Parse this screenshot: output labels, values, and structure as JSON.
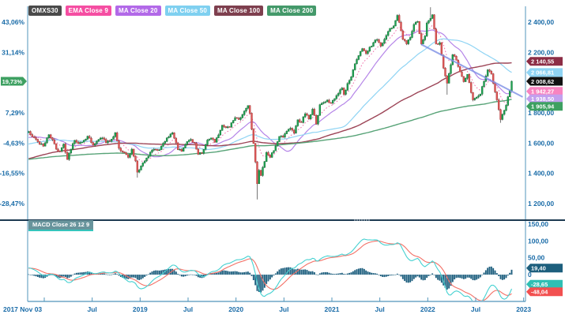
{
  "legend": {
    "items": [
      {
        "label": "OMXS30",
        "color": "#4a4a4a"
      },
      {
        "label": "EMA Close 9",
        "color": "#f54ea2"
      },
      {
        "label": "MA Close 20",
        "color": "#b269e8"
      },
      {
        "label": "MA Close 50",
        "color": "#7fd0f0"
      },
      {
        "label": "MA Close 100",
        "color": "#7e3f4e"
      },
      {
        "label": "MA Close 200",
        "color": "#44996a"
      }
    ]
  },
  "macd_legend": {
    "label": "MACD Close 26 12 9",
    "color": "#68949c",
    "underline_color": "#35c4bc"
  },
  "chart_data": {
    "type": "candlestick",
    "symbol": "OMXS30",
    "last": {
      "price": 2008.62,
      "change_pct": 19.73
    },
    "colors": {
      "axis_line": "#5295bb",
      "axis_text": "#1a6ca8",
      "divider": "#1c3a52",
      "handle_dots": "#cdd6df",
      "candle_up": "#23a457",
      "candle_up_edge": "#147a3a",
      "candle_down": "#e05a5a",
      "candle_down_edge": "#b03a3a",
      "wick": "#3c3c3c"
    },
    "x_axis": {
      "total_weeks": 270,
      "start_label": "2017 Nov 03",
      "ticks": [
        {
          "week": 9,
          "label": "",
          "year": false
        },
        {
          "week": 35,
          "label": "Jul",
          "year": false
        },
        {
          "week": 61,
          "label": "2019",
          "year": true
        },
        {
          "week": 87,
          "label": "Jul",
          "year": false
        },
        {
          "week": 113,
          "label": "2020",
          "year": true
        },
        {
          "week": 139,
          "label": "Jul",
          "year": false
        },
        {
          "week": 165,
          "label": "2021",
          "year": true
        },
        {
          "week": 191,
          "label": "Jul",
          "year": false
        },
        {
          "week": 217,
          "label": "2022",
          "year": true
        },
        {
          "week": 243,
          "label": "Jul",
          "year": false
        },
        {
          "week": 269,
          "label": "2023",
          "year": true
        }
      ]
    },
    "price_axis": {
      "range": [
        1096,
        2504
      ],
      "gridlines": [
        {
          "price": 2400,
          "left": "43,06%",
          "right": "2 400,00"
        },
        {
          "price": 2200,
          "left": "31,14%",
          "right": "2 200,00"
        },
        {
          "price": 1800,
          "left": "7,29%",
          "right": "1 800,00"
        },
        {
          "price": 1600,
          "left": "-4,63%",
          "right": "1 600,00"
        },
        {
          "price": 1400,
          "left": "-16,55%",
          "right": "1 400,00"
        },
        {
          "price": 1200,
          "left": "-28,47%",
          "right": "1 200,00"
        }
      ],
      "pct_badge": {
        "label": "19,73%",
        "value": 2008.62,
        "color": "#3da061"
      },
      "price_badges": [
        {
          "label": "2 140,55",
          "value": 2140.55,
          "color": "#8c2d46"
        },
        {
          "label": "2 066,81",
          "value": 2066.81,
          "color": "#8fd4f4"
        },
        {
          "label": "2 008,62",
          "value": 2008.62,
          "color": "#111111"
        },
        {
          "label": "1 942,27",
          "value": 1942.27,
          "color": "#f884c0"
        },
        {
          "label": "1 938,50",
          "value": 1938.5,
          "color": "#c2a0ee"
        },
        {
          "label": "1 905,94",
          "value": 1905.94,
          "color": "#3da061"
        }
      ]
    },
    "overlays": [
      {
        "name": "EMA Close 9",
        "kind": "ema",
        "period": 9,
        "last": 1942.27,
        "line_color": "#f06eaa",
        "dotted": true,
        "width": 1
      },
      {
        "name": "MA Close 20",
        "kind": "sma",
        "period": 20,
        "last": 1938.5,
        "line_color": "#b585e8",
        "dotted": false,
        "width": 1.2
      },
      {
        "name": "MA Close 50",
        "kind": "sma",
        "period": 50,
        "last": 2066.81,
        "line_color": "#8fd4f4",
        "dotted": false,
        "width": 1.2
      },
      {
        "name": "MA Close 100",
        "kind": "sma",
        "period": 100,
        "last": 2140.55,
        "line_color": "#9c4456",
        "dotted": false,
        "width": 1.4
      },
      {
        "name": "MA Close 200",
        "kind": "sma",
        "period": 200,
        "last": 1905.94,
        "line_color": "#57a377",
        "dotted": false,
        "width": 1.4
      }
    ],
    "trendline": {
      "from_week": 213,
      "from_price": 2252,
      "to_week": 268,
      "to_price": 1905,
      "color": "#7d8fe6"
    },
    "candles": {
      "interval": "weekly",
      "volatility": {
        "jitter": 9,
        "wick": 11
      },
      "prehistory": [
        [
          -200,
          1310
        ],
        [
          -185,
          1380
        ],
        [
          -170,
          1445
        ],
        [
          -155,
          1555
        ],
        [
          -145,
          1650
        ],
        [
          -135,
          1720
        ],
        [
          -125,
          1580
        ],
        [
          -118,
          1430
        ],
        [
          -110,
          1345
        ],
        [
          -103,
          1415
        ],
        [
          -95,
          1255
        ],
        [
          -88,
          1340
        ],
        [
          -80,
          1390
        ],
        [
          -75,
          1435
        ],
        [
          -68,
          1405
        ],
        [
          -60,
          1470
        ],
        [
          -55,
          1485
        ],
        [
          -48,
          1520
        ],
        [
          -42,
          1495
        ],
        [
          -35,
          1575
        ],
        [
          -28,
          1600
        ],
        [
          -20,
          1635
        ],
        [
          -14,
          1610
        ],
        [
          -8,
          1640
        ],
        [
          -3,
          1655
        ],
        [
          -1,
          1668
        ]
      ],
      "anchors": [
        [
          0,
          1677
        ],
        [
          2,
          1642
        ],
        [
          4,
          1625
        ],
        [
          6,
          1592
        ],
        [
          8,
          1580
        ],
        [
          11,
          1655
        ],
        [
          13,
          1622
        ],
        [
          15,
          1560
        ],
        [
          17,
          1546
        ],
        [
          19,
          1594
        ],
        [
          21,
          1492
        ],
        [
          23,
          1560
        ],
        [
          25,
          1618
        ],
        [
          27,
          1596
        ],
        [
          29,
          1606
        ],
        [
          32,
          1645
        ],
        [
          35,
          1586
        ],
        [
          37,
          1614
        ],
        [
          40,
          1634
        ],
        [
          42,
          1602
        ],
        [
          44,
          1612
        ],
        [
          47,
          1668
        ],
        [
          49,
          1566
        ],
        [
          52,
          1536
        ],
        [
          54,
          1506
        ],
        [
          56,
          1560
        ],
        [
          58,
          1482
        ],
        [
          59,
          1408
        ],
        [
          60,
          1422
        ],
        [
          63,
          1482
        ],
        [
          67,
          1554
        ],
        [
          71,
          1556
        ],
        [
          75,
          1634
        ],
        [
          78,
          1668
        ],
        [
          81,
          1556
        ],
        [
          83,
          1546
        ],
        [
          86,
          1610
        ],
        [
          88,
          1624
        ],
        [
          90,
          1600
        ],
        [
          92,
          1526
        ],
        [
          94,
          1532
        ],
        [
          97,
          1620
        ],
        [
          99,
          1634
        ],
        [
          101,
          1606
        ],
        [
          103,
          1654
        ],
        [
          105,
          1718
        ],
        [
          107,
          1702
        ],
        [
          109,
          1706
        ],
        [
          112,
          1768
        ],
        [
          114,
          1756
        ],
        [
          116,
          1788
        ],
        [
          119,
          1848
        ],
        [
          120,
          1798
        ],
        [
          121,
          1692
        ],
        [
          122,
          1598
        ],
        [
          123,
          1476
        ],
        [
          124,
          1332
        ],
        [
          125,
          1420
        ],
        [
          126,
          1386
        ],
        [
          128,
          1478
        ],
        [
          129,
          1538
        ],
        [
          131,
          1506
        ],
        [
          133,
          1550
        ],
        [
          136,
          1644
        ],
        [
          138,
          1640
        ],
        [
          140,
          1678
        ],
        [
          142,
          1698
        ],
        [
          144,
          1666
        ],
        [
          146,
          1754
        ],
        [
          148,
          1736
        ],
        [
          150,
          1794
        ],
        [
          152,
          1760
        ],
        [
          154,
          1824
        ],
        [
          156,
          1726
        ],
        [
          158,
          1854
        ],
        [
          160,
          1868
        ],
        [
          162,
          1884
        ],
        [
          164,
          1864
        ],
        [
          166,
          1894
        ],
        [
          168,
          1928
        ],
        [
          170,
          1964
        ],
        [
          171,
          1922
        ],
        [
          173,
          1994
        ],
        [
          175,
          2038
        ],
        [
          177,
          2124
        ],
        [
          179,
          2178
        ],
        [
          181,
          2224
        ],
        [
          183,
          2192
        ],
        [
          185,
          2234
        ],
        [
          187,
          2264
        ],
        [
          189,
          2284
        ],
        [
          191,
          2242
        ],
        [
          193,
          2286
        ],
        [
          196,
          2358
        ],
        [
          198,
          2374
        ],
        [
          200,
          2444
        ],
        [
          201,
          2398
        ],
        [
          203,
          2286
        ],
        [
          205,
          2256
        ],
        [
          207,
          2298
        ],
        [
          209,
          2384
        ],
        [
          211,
          2404
        ],
        [
          213,
          2256
        ],
        [
          215,
          2308
        ],
        [
          216,
          2394
        ],
        [
          218,
          2424
        ],
        [
          219,
          2448
        ],
        [
          221,
          2256
        ],
        [
          223,
          2264
        ],
        [
          225,
          2096
        ],
        [
          227,
          1996
        ],
        [
          229,
          2118
        ],
        [
          230,
          2184
        ],
        [
          232,
          2148
        ],
        [
          233,
          2106
        ],
        [
          235,
          2040
        ],
        [
          236,
          2006
        ],
        [
          238,
          2054
        ],
        [
          239,
          2000
        ],
        [
          241,
          1886
        ],
        [
          243,
          1904
        ],
        [
          245,
          1924
        ],
        [
          247,
          2008
        ],
        [
          249,
          2084
        ],
        [
          251,
          2058
        ],
        [
          252,
          1996
        ],
        [
          254,
          1886
        ],
        [
          256,
          1756
        ],
        [
          257,
          1790
        ],
        [
          258,
          1816
        ],
        [
          259,
          1850
        ],
        [
          260,
          1906
        ],
        [
          261,
          1946
        ],
        [
          262,
          2008.62
        ]
      ],
      "wick_overrides": {
        "59": {
          "low": 1372
        },
        "124": {
          "low": 1228
        },
        "218": {
          "high": 2498
        },
        "227": {
          "low": 1920
        },
        "256": {
          "low": 1734
        }
      }
    },
    "macd": {
      "fast": 12,
      "slow": 26,
      "signal_period": 9,
      "range": [
        -75,
        148
      ],
      "axis_labels": [
        {
          "value": 150,
          "label": "150,00"
        },
        {
          "value": 100,
          "label": "100,00"
        },
        {
          "value": 50,
          "label": "50,00"
        },
        {
          "value": 0,
          "label": "0"
        }
      ],
      "last": {
        "hist": 19.4,
        "macd": -28.65,
        "signal": -48.04
      },
      "badges": [
        {
          "label": "19,40",
          "value": 19.4,
          "color": "#1d5f7d"
        },
        {
          "label": "-28,65",
          "value": -28.65,
          "color": "#2fbfb4"
        },
        {
          "label": "-48,04",
          "value": -48.04,
          "color": "#f25050"
        }
      ],
      "macd_color": "#45d1d1",
      "signal_color": "#f37066",
      "hist_color": "#1e5f7f"
    }
  }
}
